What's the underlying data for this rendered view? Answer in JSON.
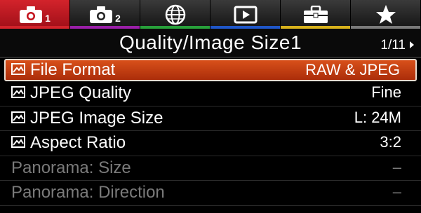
{
  "tabs": [
    {
      "icon": "camera-icon",
      "num": "1",
      "stripe": "#d3232b",
      "active": true
    },
    {
      "icon": "camera-icon",
      "num": "2",
      "stripe": "#9a1fa8",
      "active": false
    },
    {
      "icon": "globe-icon",
      "num": "",
      "stripe": "#28a03a",
      "active": false
    },
    {
      "icon": "playback-icon",
      "num": "",
      "stripe": "#1f56c8",
      "active": false
    },
    {
      "icon": "toolbox-icon",
      "num": "",
      "stripe": "#d8b21c",
      "active": false
    },
    {
      "icon": "star-icon",
      "num": "",
      "stripe": "#7a7a7a",
      "active": false
    }
  ],
  "header": {
    "title": "Quality/Image Size1",
    "page": "1/11"
  },
  "rows": [
    {
      "label": "File Format",
      "value": "RAW & JPEG",
      "icon": "image-settings-icon"
    },
    {
      "label": "JPEG Quality",
      "value": "Fine",
      "icon": "image-settings-icon"
    },
    {
      "label": "JPEG Image Size",
      "value": "L: 24M",
      "icon": "image-settings-icon"
    },
    {
      "label": "Aspect Ratio",
      "value": "3:2",
      "icon": "image-settings-icon"
    },
    {
      "label": "Panorama: Size",
      "value": "–"
    },
    {
      "label": "Panorama: Direction",
      "value": "–"
    }
  ],
  "colors": {
    "accent": "#d3232b",
    "selected_row": "#c2411a",
    "disabled_text": "#7a7a7a"
  }
}
